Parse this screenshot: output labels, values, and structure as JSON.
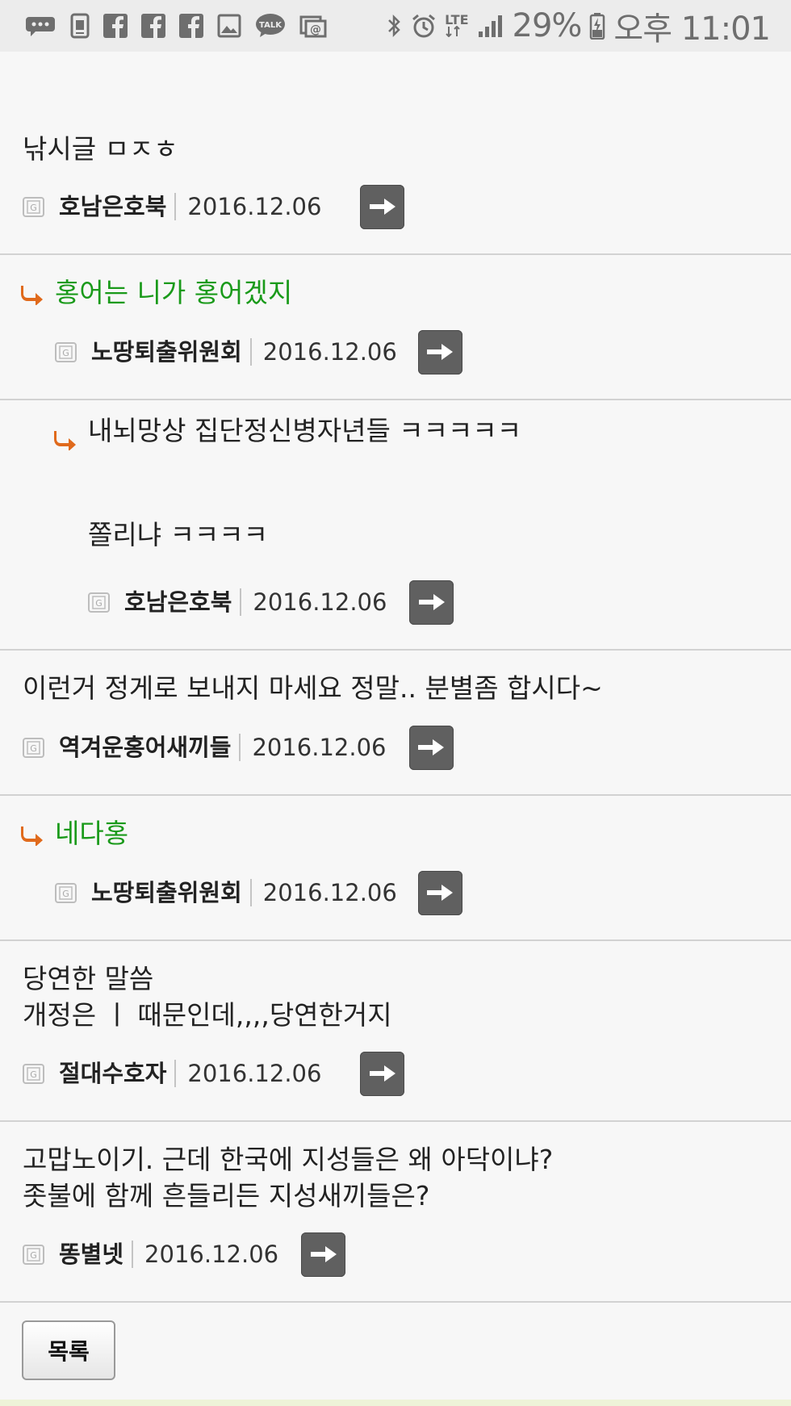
{
  "status_bar": {
    "battery": "29%",
    "time": "오후 11:01",
    "network": "LTE",
    "icons": [
      "more-icon",
      "sim-card-icon",
      "facebook-icon",
      "facebook-icon",
      "facebook-icon",
      "image-icon",
      "kakaotalk-icon",
      "email-icon",
      "bluetooth-icon",
      "alarm-icon",
      "lte-icon",
      "signal-icon",
      "battery-charging-icon"
    ]
  },
  "comments": [
    {
      "body": "낚시글 ㅁㅈㅎ",
      "author": "호남은호북",
      "date": "2016.12.06",
      "reply_level": 0
    },
    {
      "body": "홍어는 니가 홍어겠지",
      "author": "노땅퇴출위원회",
      "date": "2016.12.06",
      "reply_level": 1
    },
    {
      "body": "내뇌망상 집단정신병자년들 ㅋㅋㅋㅋㅋ\n\n\n쫄리냐 ㅋㅋㅋㅋ",
      "author": "호남은호북",
      "date": "2016.12.06",
      "reply_level": 2
    },
    {
      "body": "이런거 정게로 보내지 마세요 정말.. 분별좀 합시다~",
      "author": "역겨운홍어새끼들",
      "date": "2016.12.06",
      "reply_level": 0
    },
    {
      "body": "네다홍",
      "author": "노땅퇴출위원회",
      "date": "2016.12.06",
      "reply_level": 1
    },
    {
      "body": "당연한 말씀\n개정은 ㅣ 때문인데,,,,당연한거지",
      "author": "절대수호자",
      "date": "2016.12.06",
      "reply_level": 0
    },
    {
      "body": "고맙노이기. 근데 한국에 지성들은 왜 아닥이냐?\n좃불에 함께 흔들리든 지성새끼들은?",
      "author": "똥별넷",
      "date": "2016.12.06",
      "reply_level": 0
    }
  ],
  "list_button_label": "목록",
  "colors": {
    "reply_text": "#1a9a1a",
    "reply_arrow": "#e06a1c",
    "arrow_button": "#606060"
  }
}
